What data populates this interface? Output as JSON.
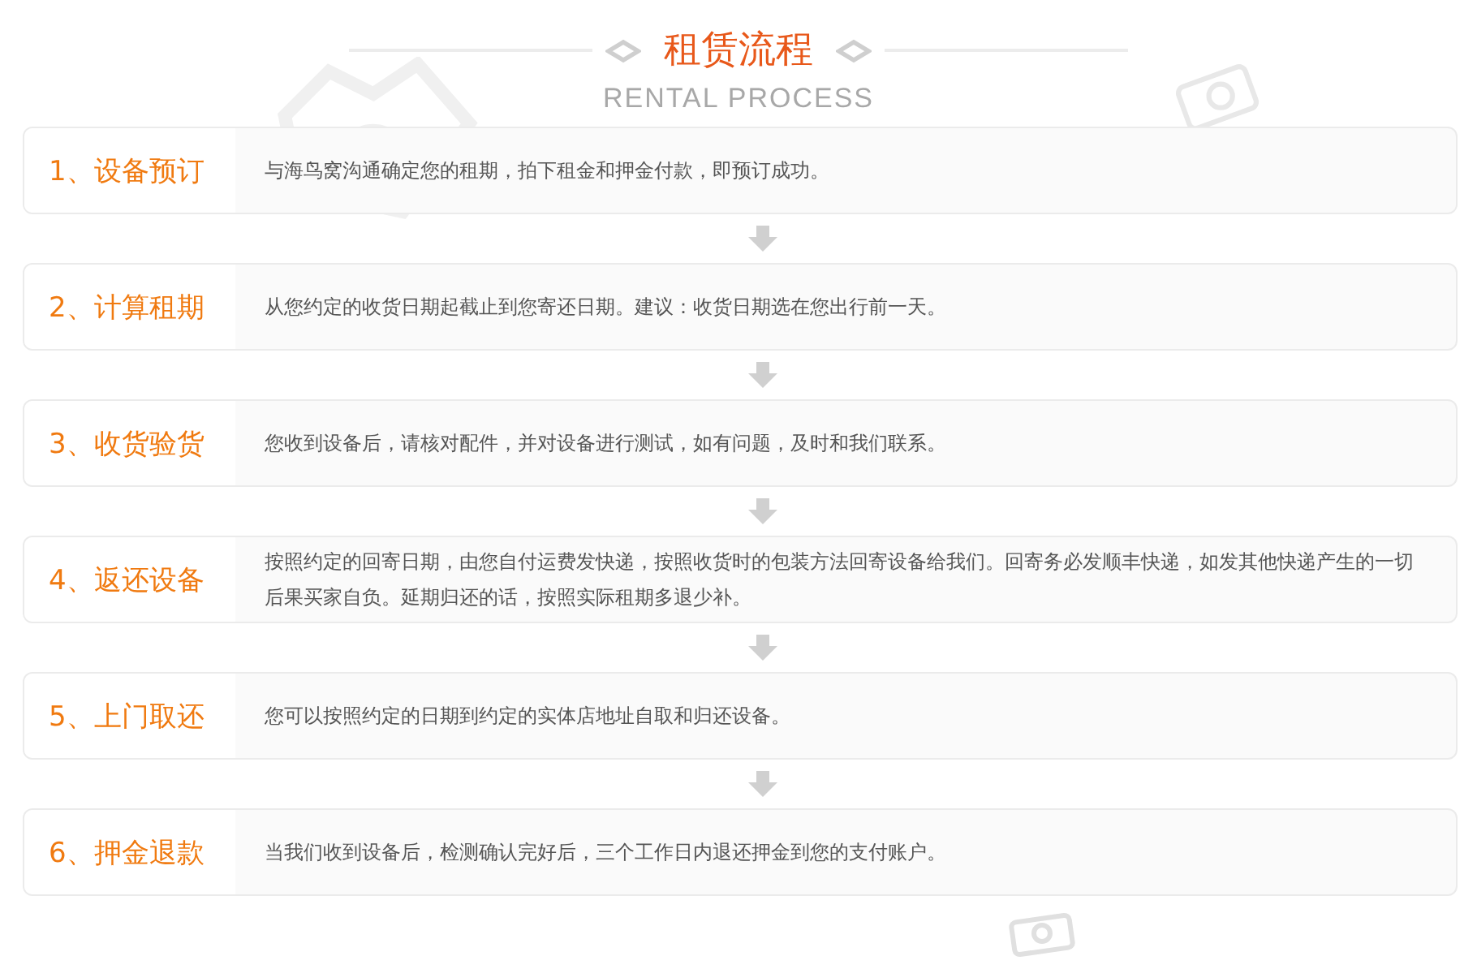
{
  "header": {
    "title": "租赁流程",
    "subtitle": "RENTAL PROCESS"
  },
  "steps": [
    {
      "label": "1、设备预订",
      "text": "与海鸟窝沟通确定您的租期，拍下租金和押金付款，即预订成功。"
    },
    {
      "label": "2、计算租期",
      "text": "从您约定的收货日期起截止到您寄还日期。建议：收货日期选在您出行前一天。"
    },
    {
      "label": "3、收货验货",
      "text": "您收到设备后，请核对配件，并对设备进行测试，如有问题，及时和我们联系。"
    },
    {
      "label": "4、返还设备",
      "text": "按照约定的回寄日期，由您自付运费发快递，按照收货时的包装方法回寄设备给我们。回寄务必发顺丰快递，如发其他快递产生的一切后果买家自负。延期归还的话，按照实际租期多退少补。"
    },
    {
      "label": "5、上门取还",
      "text": "您可以按照约定的日期到约定的实体店地址自取和归还设备。"
    },
    {
      "label": "6、押金退款",
      "text": "当我们收到设备后，检测确认完好后，三个工作日内退还押金到您的支付账户。"
    }
  ]
}
